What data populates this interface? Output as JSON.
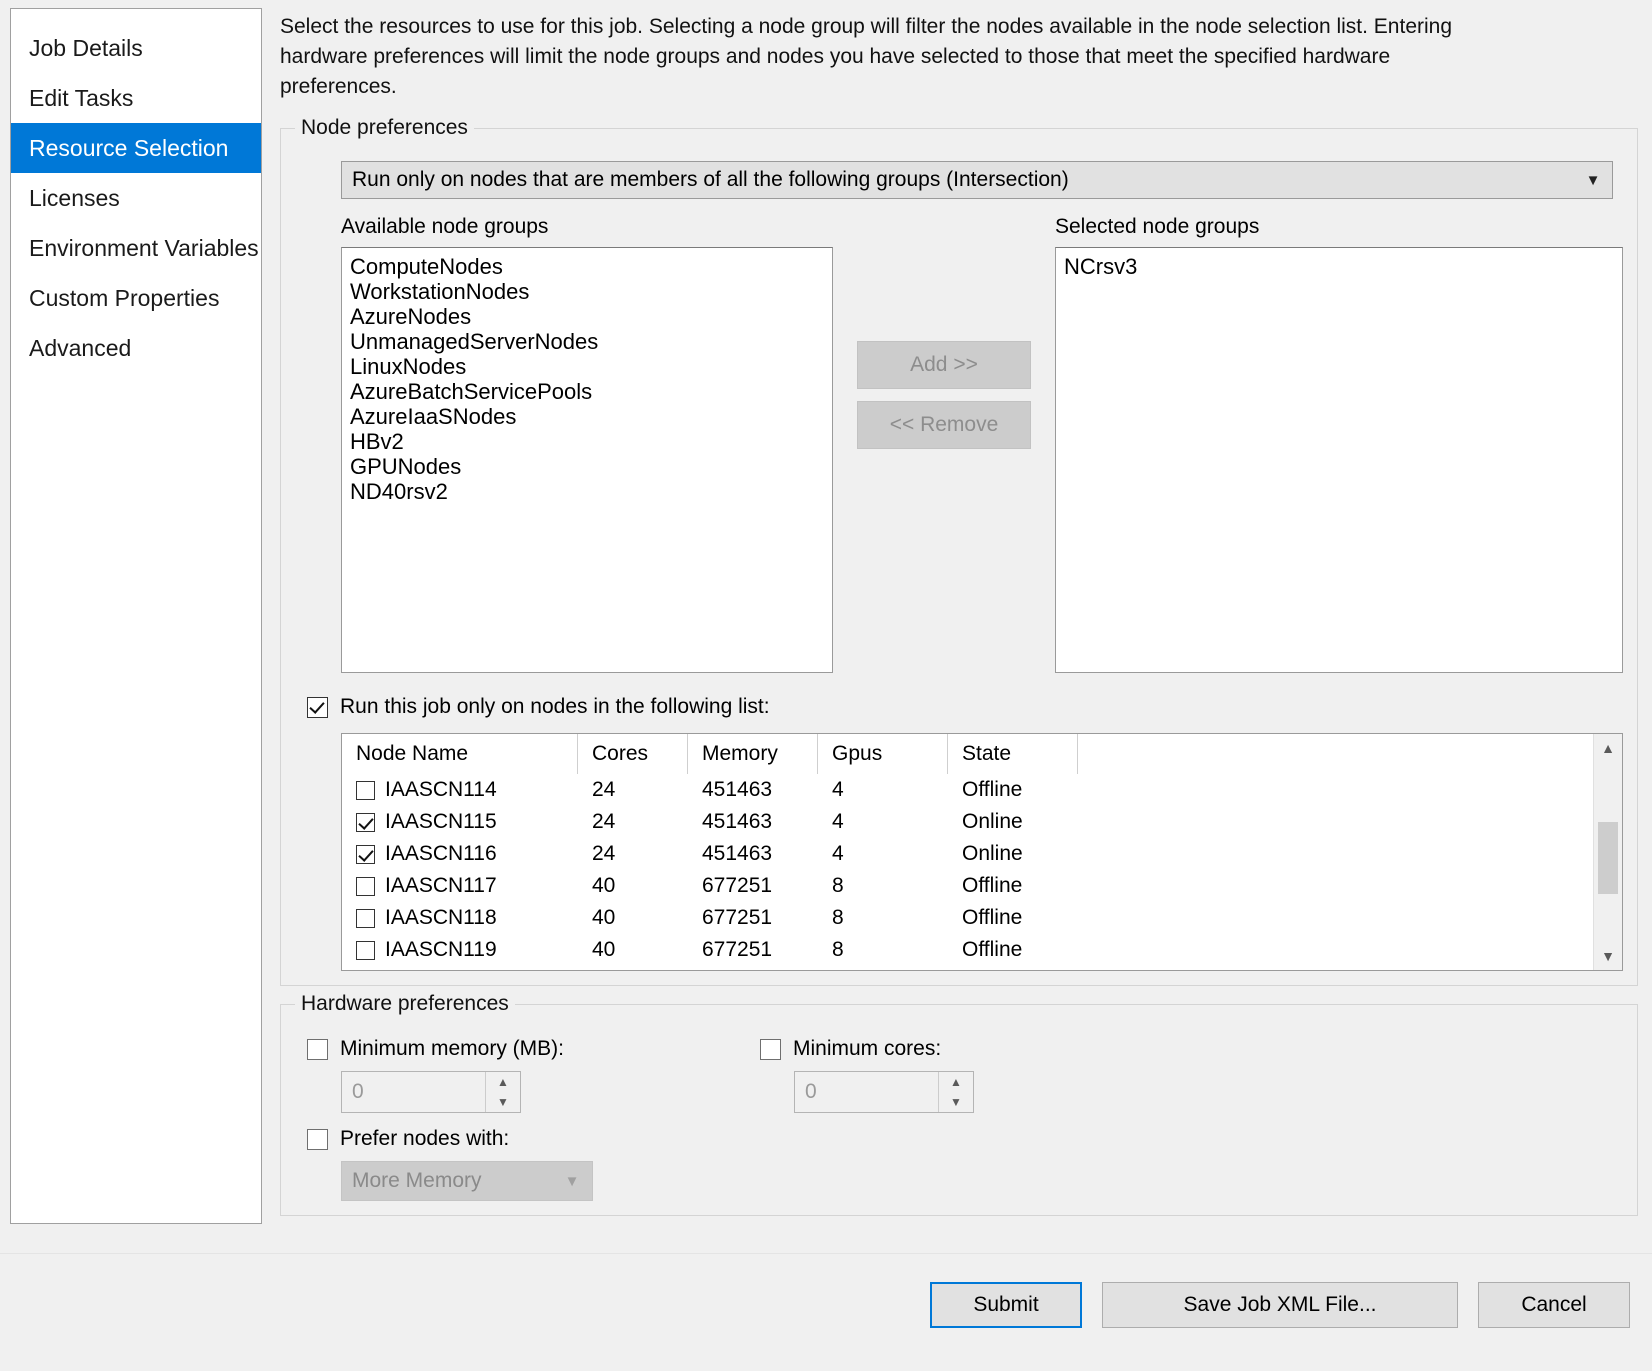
{
  "sidebar": {
    "items": [
      {
        "label": "Job Details",
        "active": false
      },
      {
        "label": "Edit Tasks",
        "active": false
      },
      {
        "label": "Resource Selection",
        "active": true
      },
      {
        "label": "Licenses",
        "active": false
      },
      {
        "label": "Environment Variables",
        "active": false
      },
      {
        "label": "Custom Properties",
        "active": false
      },
      {
        "label": "Advanced",
        "active": false
      }
    ],
    "active_color": "#0078d7"
  },
  "main": {
    "intro": "Select the resources to use for this job. Selecting a node group will filter the nodes available in the node selection list. Entering hardware preferences will limit the node groups and nodes you have selected to those that meet the specified hardware preferences."
  },
  "node_preferences": {
    "group_title": "Node preferences",
    "mode_combo": {
      "value": "Run only on nodes that are members of all the following groups (Intersection)",
      "chevron": "chevron-down-icon"
    },
    "available_label": "Available node groups",
    "available_groups": [
      "ComputeNodes",
      "WorkstationNodes",
      "AzureNodes",
      "UnmanagedServerNodes",
      "LinuxNodes",
      "AzureBatchServicePools",
      "AzureIaaSNodes",
      "HBv2",
      "GPUNodes",
      "ND40rsv2"
    ],
    "add_button": "Add >>",
    "remove_button": "<< Remove",
    "selected_label": "Selected node groups",
    "selected_groups": [
      "NCrsv3"
    ],
    "run_only_checkbox": {
      "label": "Run this job only on nodes in the following list:",
      "checked": true
    },
    "node_table": {
      "columns": [
        "Node Name",
        "Cores",
        "Memory",
        "Gpus",
        "State"
      ],
      "rows": [
        {
          "checked": false,
          "name": "IAASCN114",
          "cores": "24",
          "memory": "451463",
          "gpus": "4",
          "state": "Offline"
        },
        {
          "checked": true,
          "name": "IAASCN115",
          "cores": "24",
          "memory": "451463",
          "gpus": "4",
          "state": "Online"
        },
        {
          "checked": true,
          "name": "IAASCN116",
          "cores": "24",
          "memory": "451463",
          "gpus": "4",
          "state": "Online"
        },
        {
          "checked": false,
          "name": "IAASCN117",
          "cores": "40",
          "memory": "677251",
          "gpus": "8",
          "state": "Offline"
        },
        {
          "checked": false,
          "name": "IAASCN118",
          "cores": "40",
          "memory": "677251",
          "gpus": "8",
          "state": "Offline"
        },
        {
          "checked": false,
          "name": "IAASCN119",
          "cores": "40",
          "memory": "677251",
          "gpus": "8",
          "state": "Offline"
        }
      ],
      "scroll_up_icon": "chevron-up-icon",
      "scroll_down_icon": "chevron-down-icon"
    }
  },
  "hardware_preferences": {
    "group_title": "Hardware preferences",
    "min_memory": {
      "label": "Minimum memory (MB):",
      "checked": false,
      "value": "0"
    },
    "min_cores": {
      "label": "Minimum cores:",
      "checked": false,
      "value": "0"
    },
    "prefer_nodes": {
      "label": "Prefer nodes with:",
      "checked": false,
      "value": "More Memory",
      "chevron": "chevron-down-icon"
    }
  },
  "footer": {
    "submit": "Submit",
    "save_xml": "Save Job XML File...",
    "cancel": "Cancel"
  }
}
